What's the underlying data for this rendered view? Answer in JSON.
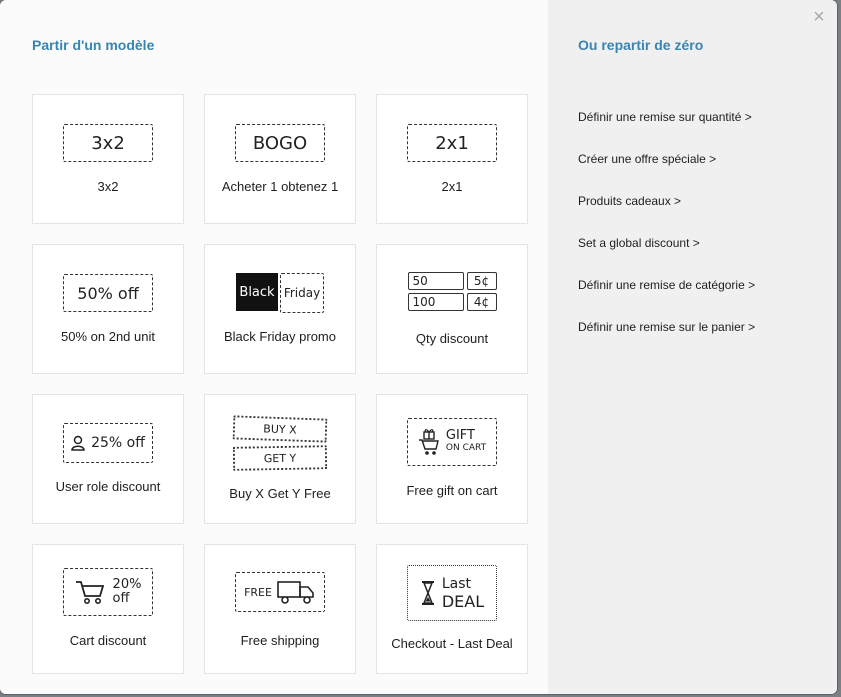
{
  "left": {
    "title": "Partir d'un modèle",
    "cards": [
      {
        "art": "3x2",
        "label": "3x2"
      },
      {
        "art": "BOGO",
        "label": "Acheter 1 obtenez 1"
      },
      {
        "art": "2x1",
        "label": "2x1"
      },
      {
        "art": "50% off",
        "label": "50% on 2nd unit"
      },
      {
        "art_black": "Black",
        "art_friday": "Friday",
        "label": "Black Friday promo"
      },
      {
        "qty1": "50",
        "price1": "5¢",
        "qty2": "100",
        "price2": "4¢",
        "label": "Qty discount"
      },
      {
        "art": "25% off",
        "label": "User role discount"
      },
      {
        "art_buy": "BUY X",
        "art_get": "GET Y",
        "label": "Buy X Get Y Free"
      },
      {
        "art_gift": "GIFT",
        "art_cart": "ON CART",
        "label": "Free gift on cart"
      },
      {
        "art_pct": "20%",
        "art_off": "off",
        "label": "Cart discount"
      },
      {
        "art": "FREE",
        "label": "Free shipping"
      },
      {
        "art_last": "Last",
        "art_deal": "DEAL",
        "label": "Checkout - Last Deal"
      }
    ]
  },
  "right": {
    "title": "Ou repartir de zéro",
    "links": [
      "Définir une remise sur quantité >",
      "Créer une offre spéciale >",
      "Produits cadeaux >",
      "Set a global discount >",
      "Définir une remise de catégorie >",
      "Définir une remise sur le panier >"
    ]
  },
  "close_glyph": "×"
}
